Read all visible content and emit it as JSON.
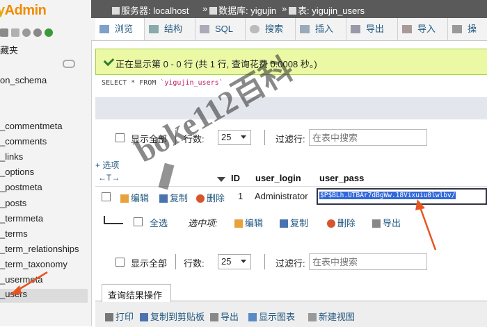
{
  "sidebar": {
    "logo_prefix": "y",
    "logo_suffix": "Admin",
    "favorites_label": "藏夹",
    "schema": "on_schema",
    "tables": [
      "_commentmeta",
      "_comments",
      "_links",
      "_options",
      "_postmeta",
      "_posts",
      "_termmeta",
      "_terms",
      "_term_relationships",
      "_term_taxonomy",
      "_usermeta",
      "_users"
    ]
  },
  "breadcrumb": {
    "server": "服务器: localhost",
    "sep1": "»",
    "database": "数据库: yigujin",
    "sep2": "»",
    "table": "表: yigujin_users"
  },
  "tabs": [
    "浏览",
    "结构",
    "SQL",
    "搜索",
    "插入",
    "导出",
    "导入",
    "操"
  ],
  "message": "正在显示第 0 - 0 行 (共 1 行, 查询花费 0.0008 秒。)",
  "sql": {
    "select": "SELECT",
    "star": "*",
    "from": "FROM",
    "table": "`yigujin_users`"
  },
  "controls": {
    "show_all": "显示全部",
    "rows_label": "行数:",
    "rows_value": "25",
    "filter_label": "过滤行:",
    "filter_placeholder": "在表中搜索"
  },
  "table": {
    "add_options": "+ 选项",
    "arrows": "←T→",
    "columns": [
      "ID",
      "user_login",
      "user_pass"
    ],
    "row": {
      "edit": "编辑",
      "copy": "复制",
      "delete": "删除",
      "id": "1",
      "login": "Administrator",
      "pass": "$P$BLh.UTBAr7dBgWw.18Vixuiu0lwlbv/"
    }
  },
  "bulk": {
    "check_all": "全选",
    "selected_label": "选中项:",
    "edit": "编辑",
    "copy": "复制",
    "delete": "删除",
    "export": "导出"
  },
  "query_results": {
    "title": "查询结果操作",
    "actions": [
      "打印",
      "复制到剪贴板",
      "导出",
      "显示图表",
      "新建视图"
    ]
  },
  "watermark": "boke112百科",
  "colors": {
    "accent": "#235a81",
    "success_bg": "#ebf8a4",
    "highlight": "#3268d8",
    "annotation": "#e8541e"
  }
}
